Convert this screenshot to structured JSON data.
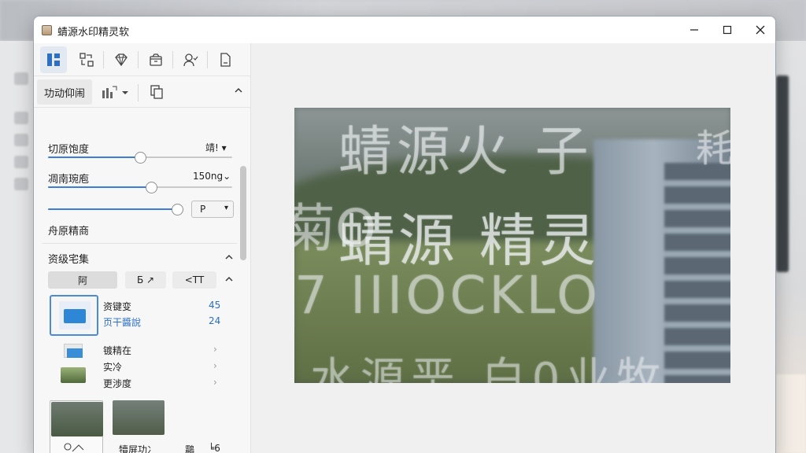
{
  "window": {
    "title": "蜻源水印精灵软"
  },
  "toolbar": {
    "icons": [
      "layout-icon",
      "transform-icon",
      "diamond-icon",
      "box-icon",
      "user-icon",
      "document-icon"
    ]
  },
  "subbar": {
    "tab_label": "功动仰闹"
  },
  "settings": {
    "row1": {
      "label": "切原饱度",
      "value": "靖!",
      "fraction": 0.5
    },
    "row2": {
      "label": "凋南琬庖",
      "value": "150ng",
      "fraction": 0.56
    },
    "row3": {
      "fraction": 0.98,
      "select_value": "P"
    },
    "row4": {
      "label": "舟原精商"
    }
  },
  "resources": {
    "title": "资级宅集",
    "chips": [
      "阿",
      "Б",
      "<TT"
    ],
    "item1": {
      "name": "资键变",
      "sub": "页干醬說",
      "n1": "45",
      "n2": "24"
    },
    "item2": {
      "line1": "镀精在",
      "line2": "实冷",
      "line3": "更渉度"
    },
    "thumb_caption": "犢屏功冫",
    "thumb_caption2": "鸘",
    "thumb_caption3": "╘6"
  },
  "preview": {
    "wm_line1": "蜻源火 子",
    "wm_line2": "蜻源 精灵",
    "wm_line3": "7 IIIOCKLO",
    "wm_line4": "水源垩 白0业牧",
    "wm_side": "耗 名 那",
    "wm_left": "菊O"
  }
}
